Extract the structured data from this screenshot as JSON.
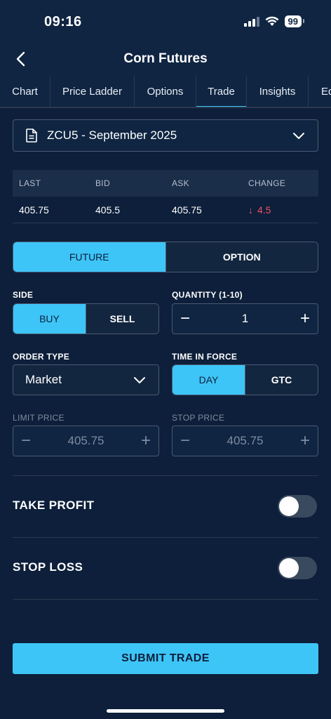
{
  "status_bar": {
    "time": "09:16",
    "battery": "99"
  },
  "header": {
    "title": "Corn Futures"
  },
  "tabs": [
    {
      "label": "Chart"
    },
    {
      "label": "Price Ladder"
    },
    {
      "label": "Options"
    },
    {
      "label": "Trade",
      "active": true
    },
    {
      "label": "Insights"
    },
    {
      "label": "Ed"
    }
  ],
  "contract": {
    "selected": "ZCU5 - September 2025"
  },
  "quote": {
    "headers": [
      "LAST",
      "BID",
      "ASK",
      "CHANGE"
    ],
    "last": "405.75",
    "bid": "405.5",
    "ask": "405.75",
    "change_arrow": "↓",
    "change": "4.5",
    "change_color": "#f0506a"
  },
  "instrument": {
    "future": "FUTURE",
    "option": "OPTION",
    "selected": "FUTURE"
  },
  "side": {
    "label": "SIDE",
    "buy": "BUY",
    "sell": "SELL",
    "selected": "BUY"
  },
  "quantity": {
    "label": "QUANTITY (1-10)",
    "value": "1",
    "minus": "−",
    "plus": "+"
  },
  "order_type": {
    "label": "ORDER TYPE",
    "value": "Market"
  },
  "time_in_force": {
    "label": "TIME IN FORCE",
    "day": "DAY",
    "gtc": "GTC",
    "selected": "DAY"
  },
  "limit_price": {
    "label": "LIMIT PRICE",
    "value": "405.75",
    "minus": "−",
    "plus": "+"
  },
  "stop_price": {
    "label": "STOP PRICE",
    "value": "405.75",
    "minus": "−",
    "plus": "+"
  },
  "take_profit": {
    "label": "TAKE PROFIT",
    "enabled": false
  },
  "stop_loss": {
    "label": "STOP LOSS",
    "enabled": false
  },
  "submit": {
    "label": "SUBMIT TRADE"
  },
  "colors": {
    "accent": "#3ec5f8",
    "background": "#0d1f3a",
    "negative": "#f0506a"
  }
}
